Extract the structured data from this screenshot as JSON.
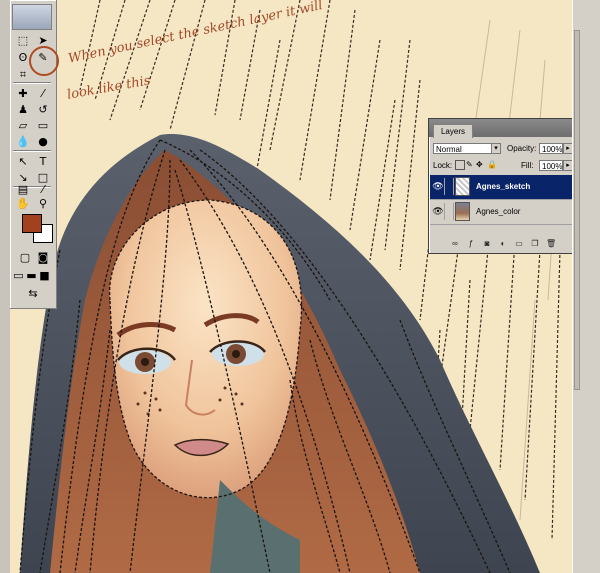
{
  "annotation": {
    "line1": "When you select the sketch layer it will",
    "line2": "look like this"
  },
  "colors": {
    "foreground": "#a3401e",
    "background": "#ffffff",
    "canvas_bg": "#f5e6c4",
    "hair": "#4d5562",
    "skin": "#f0c8a0",
    "selected_layer": "#0a246a"
  },
  "layers_panel": {
    "tab": "Layers",
    "blend_mode": "Normal",
    "opacity_label": "Opacity:",
    "opacity_value": "100%",
    "lock_label": "Lock:",
    "fill_label": "Fill:",
    "fill_value": "100%",
    "layers": [
      {
        "name": "Agnes_sketch",
        "selected": true
      },
      {
        "name": "Agnes_color",
        "selected": false
      }
    ]
  },
  "toolbox": {
    "highlighted_tool": "pen-icon"
  }
}
